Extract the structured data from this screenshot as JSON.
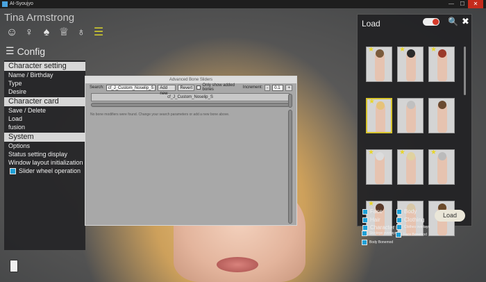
{
  "window": {
    "title": "AI-Syoujyo"
  },
  "character": {
    "name": "Tina Armstrong"
  },
  "top_icons": [
    {
      "icon": "smiley-icon",
      "glyph": "☺"
    },
    {
      "icon": "body-icon",
      "glyph": "♀"
    },
    {
      "icon": "hair-icon",
      "glyph": "♠"
    },
    {
      "icon": "clothing-icon",
      "glyph": "♕"
    },
    {
      "icon": "accessory-icon",
      "glyph": "♁"
    },
    {
      "icon": "list-icon",
      "glyph": "☰"
    }
  ],
  "config": {
    "label": "Config",
    "icon_glyph": "☰"
  },
  "left_menu": {
    "character_setting": {
      "header": "Character setting",
      "items": [
        "Name / Birthday",
        "Type",
        "Desire"
      ]
    },
    "character_card": {
      "header": "Character card",
      "items": [
        "Save / Delete",
        "Load",
        "fusion"
      ]
    },
    "system": {
      "header": "System",
      "items": [
        "Options",
        "Status setting display",
        "Window layout initialization"
      ],
      "checkbox_label": "Slider wheel operation"
    }
  },
  "dialog": {
    "title": "Advanced Bone Sliders",
    "search_label": "Search:",
    "search_value": "cf_J_Custom_Noselip_S",
    "add_new": "Add new",
    "revert": "Revert",
    "only_show_label": "Only show added bones",
    "increment_label": "Increment:",
    "increment_minus": "-",
    "increment_value": "0.1",
    "increment_plus": "+",
    "bone_entry": "cf_J_Custom_Noselip_S",
    "message": "No bone modifiers were found. Change your search parameters or add a new bone above."
  },
  "load_panel": {
    "title": "Load",
    "close_glyph": "✖",
    "search_glyph": "🔍",
    "load_button": "Load",
    "filters": {
      "face": "Face",
      "body": "Body",
      "hair": "Hair",
      "clothing": "Clothing",
      "character": "Character",
      "clothes_overlays": "Clothes overlays",
      "skin_eye_overlays": "Skin/eye overlays",
      "face_bonemod": "Face Bonemod",
      "body_bonemod": "Body Bonemod"
    },
    "thumbnails": [
      {
        "star": true,
        "hair": "#7a5b3c"
      },
      {
        "star": true,
        "hair": "#2a2a2a"
      },
      {
        "star": true,
        "hair": "#9b3a2a"
      },
      {
        "star": true,
        "hair": "#e6c37a",
        "selected": true
      },
      {
        "star": false,
        "hair": "#c0c0c0"
      },
      {
        "star": false,
        "hair": "#6a4a30"
      },
      {
        "star": true,
        "hair": "#dcdcdc"
      },
      {
        "star": true,
        "hair": "#e0d2a0"
      },
      {
        "star": true,
        "hair": "#bbbbbb"
      },
      {
        "star": true,
        "hair": "#5a3a2a"
      },
      {
        "star": false,
        "hair": "#d8c8a8"
      },
      {
        "star": false,
        "hair": "#6b4a2a"
      }
    ]
  }
}
